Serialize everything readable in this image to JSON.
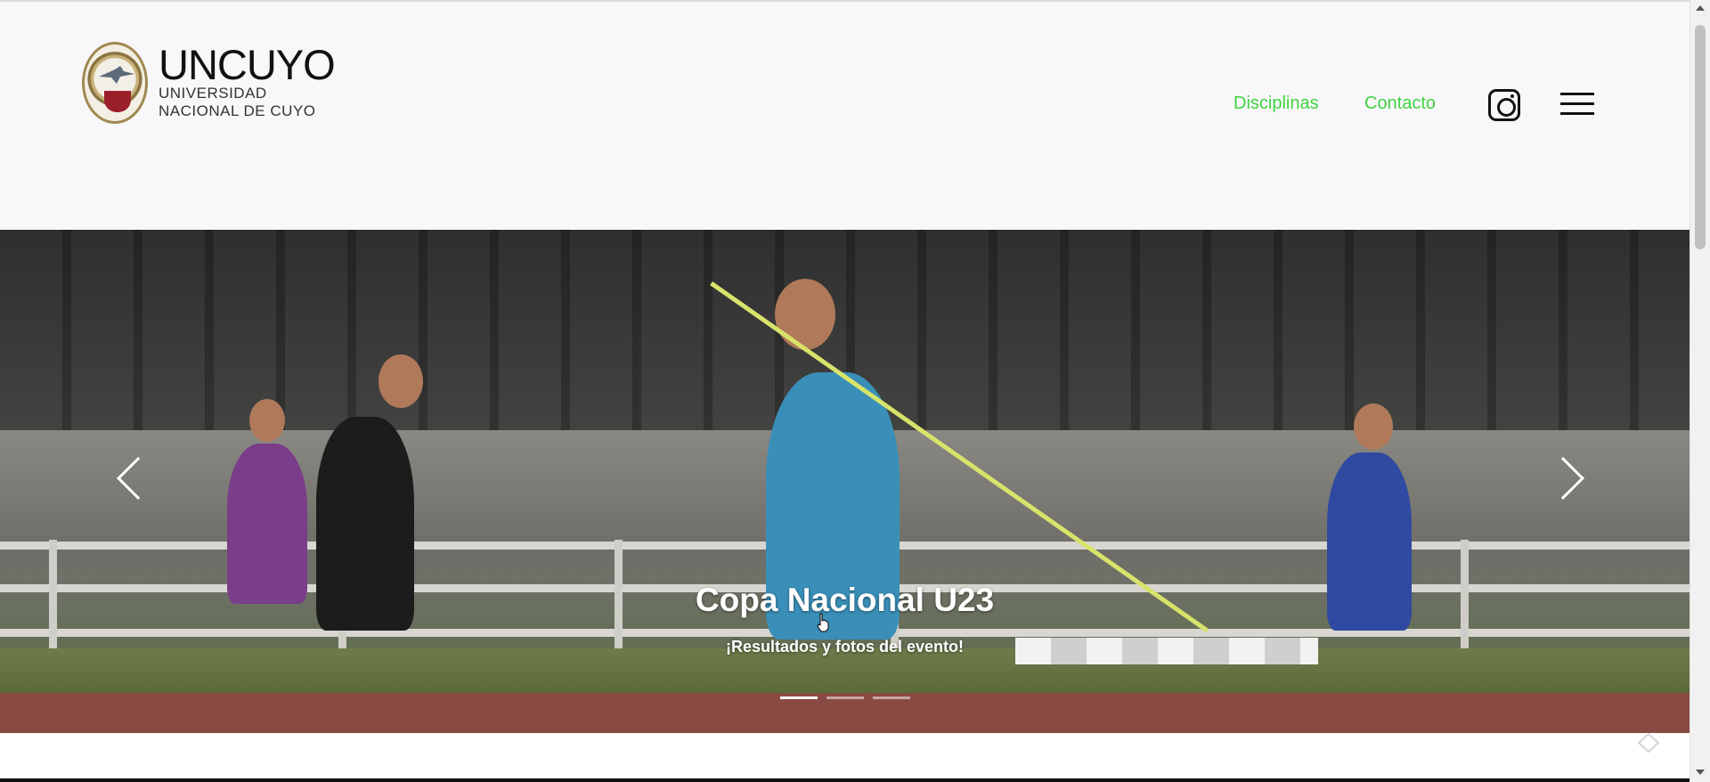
{
  "logo": {
    "name": "UNCUYO",
    "subtitle_line1": "UNIVERSIDAD",
    "subtitle_line2": "NACIONAL DE CUYO"
  },
  "nav": {
    "links": [
      {
        "label": "Disciplinas"
      },
      {
        "label": "Contacto"
      }
    ],
    "link_color": "#3ed33e",
    "icons": [
      "instagram-icon",
      "hamburger-menu-icon"
    ]
  },
  "hero": {
    "title": "Copa Nacional U23",
    "subtitle": "¡Resultados y fotos del evento!",
    "slide_count": 3,
    "active_slide": 1,
    "controls": [
      "chevron-left-icon",
      "chevron-right-icon"
    ]
  }
}
